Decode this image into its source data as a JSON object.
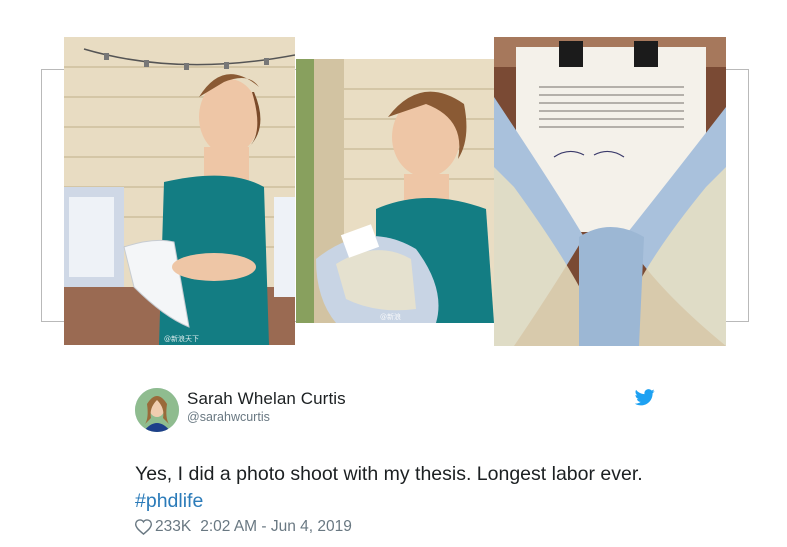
{
  "photos": [
    {
      "alt": "Woman holding thesis like a baby bump",
      "watermark": "@新浪天下"
    },
    {
      "alt": "Woman cradling thesis wrapped in blanket",
      "watermark": "@新浪"
    },
    {
      "alt": "Thesis wrapped in crocheted blanket",
      "watermark": ""
    }
  ],
  "tweet": {
    "display_name": "Sarah Whelan Curtis",
    "handle": "@sarahwcurtis",
    "text_main": "Yes, I did a photo shoot with my thesis. Longest labor ever.",
    "hashtag": "#phdlife",
    "likes": "233K",
    "timestamp": "2:02 AM - Jun 4, 2019"
  },
  "icons": {
    "brand": "twitter-bird-icon",
    "like": "heart-icon"
  },
  "colors": {
    "twitter_blue": "#1da1f2",
    "hashtag": "#2b7bb9",
    "text": "#1c2022",
    "secondary": "#697882"
  }
}
